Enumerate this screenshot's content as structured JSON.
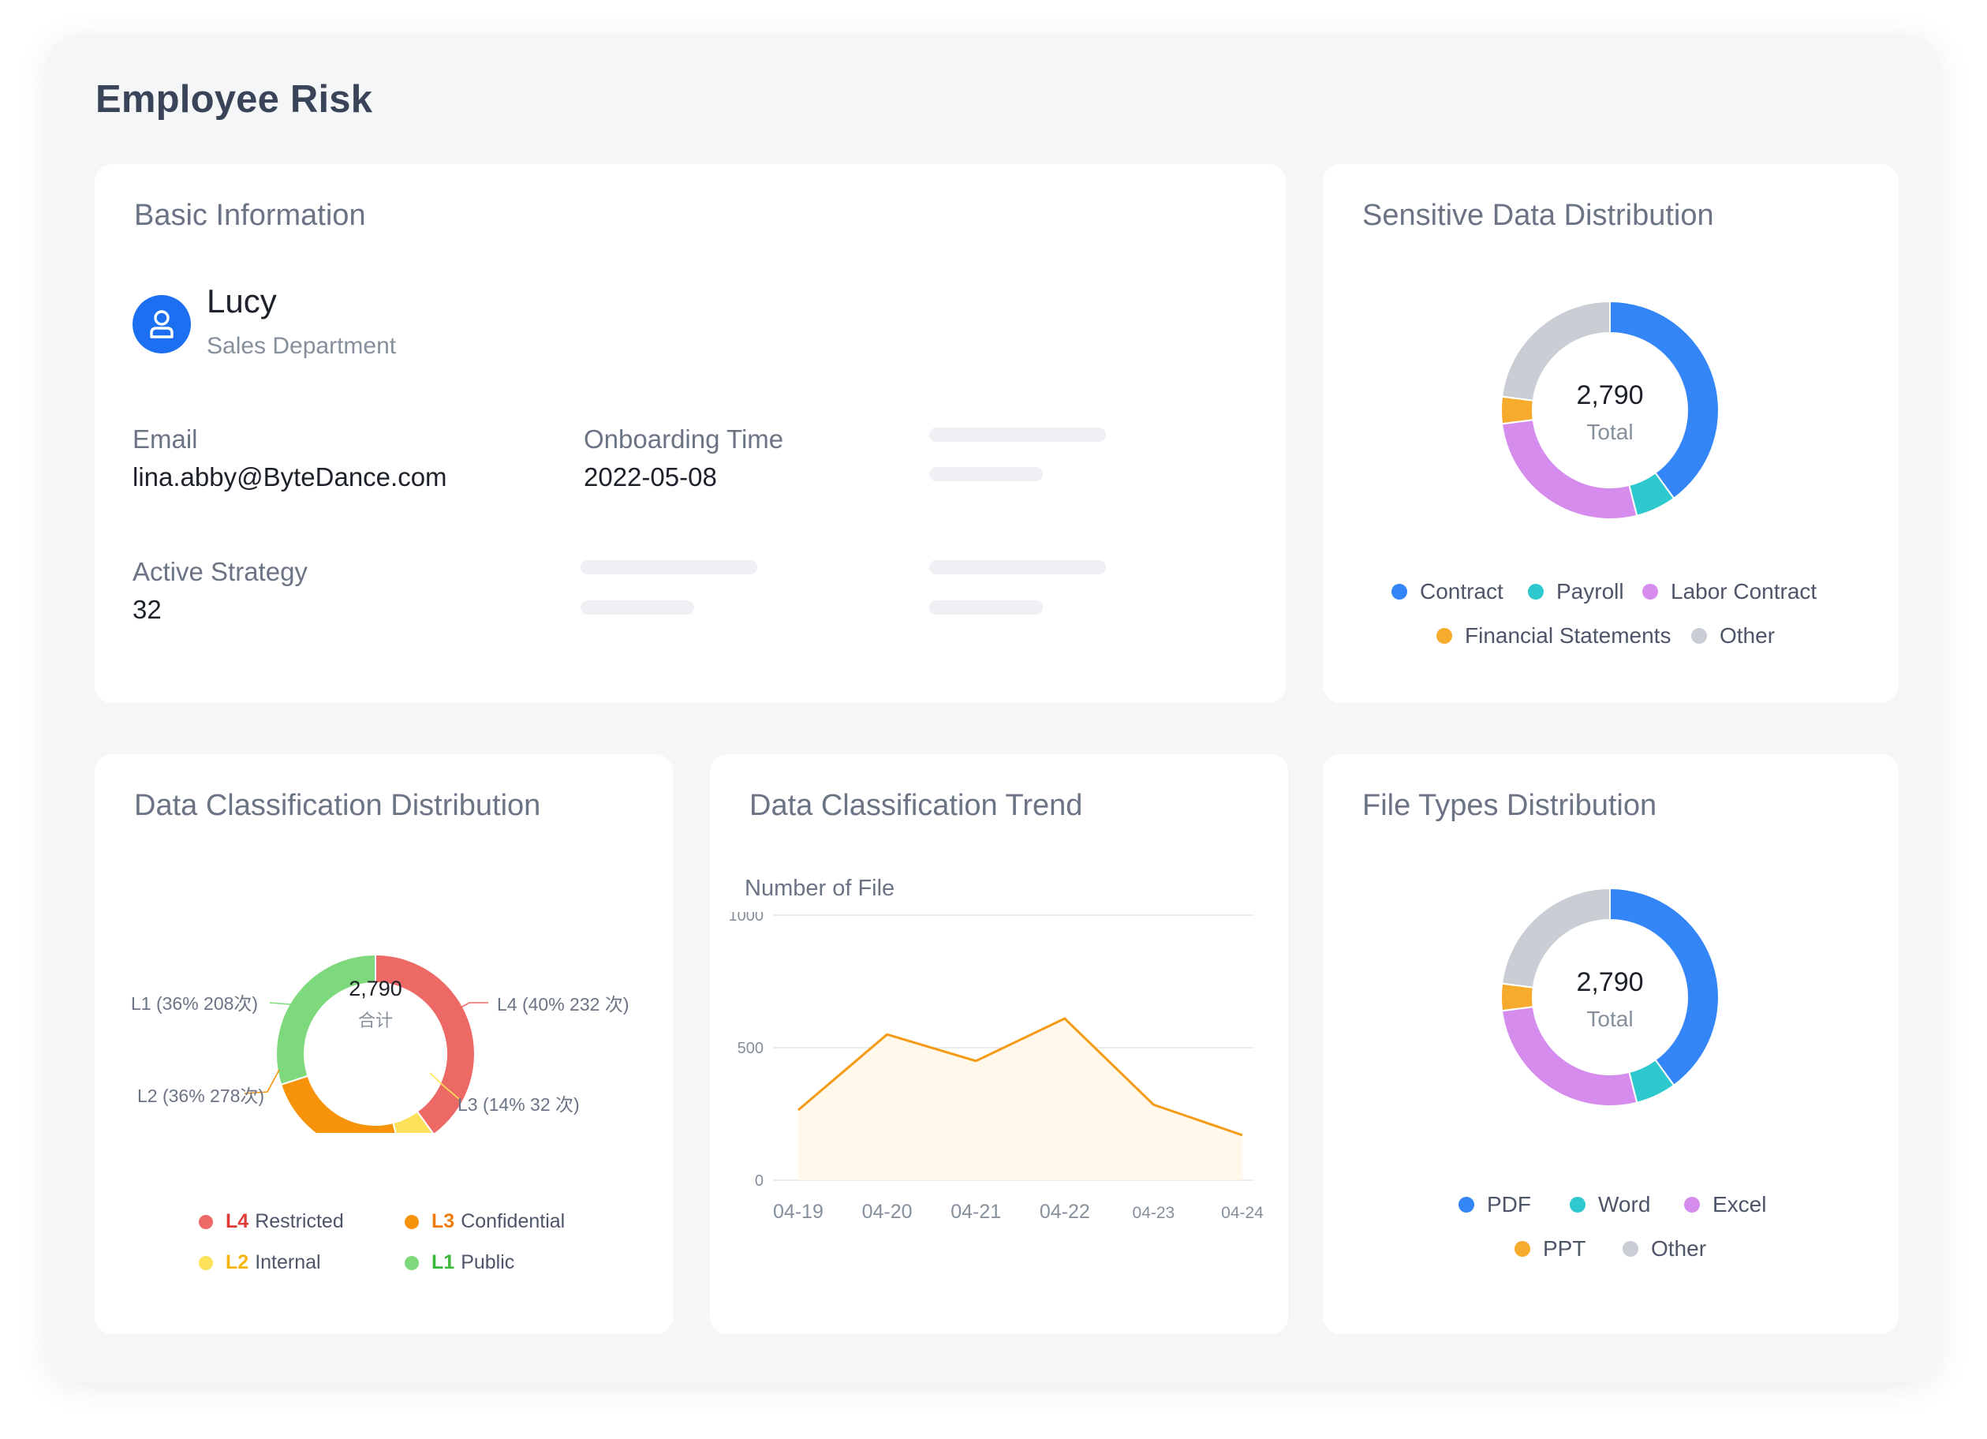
{
  "page_title": "Employee Risk",
  "basic_info": {
    "title": "Basic Information",
    "name": "Lucy",
    "department": "Sales Department",
    "email_label": "Email",
    "email_value": "lina.abby@ByteDance.com",
    "onboarding_label": "Onboarding Time",
    "onboarding_value": "2022-05-08",
    "strategy_label": "Active Strategy",
    "strategy_value": "32"
  },
  "sensitive": {
    "title": "Sensitive Data Distribution",
    "total": "2,790",
    "total_label": "Total",
    "legend": {
      "contract": "Contract",
      "payroll": "Payroll",
      "labor": "Labor Contract",
      "financial": "Financial Statements",
      "other": "Other"
    }
  },
  "classification": {
    "title": "Data Classification Distribution",
    "total": "2,790",
    "total_label": "合计",
    "labels": {
      "l4": "L4 (40% 232 次)",
      "l3": "L3 (14% 32 次)",
      "l2": "L2 (36% 278次)",
      "l1": "L1 (36% 208次)"
    },
    "legend": {
      "l4_code": "L4",
      "l4_name": "Restricted",
      "l3_code": "L3",
      "l3_name": "Confidential",
      "l2_code": "L2",
      "l2_name": "Internal",
      "l1_code": "L1",
      "l1_name": "Public"
    }
  },
  "trend": {
    "title": "Data Classification Trend",
    "ylabel": "Number of File"
  },
  "filetypes": {
    "title": "File Types Distribution",
    "total": "2,790",
    "total_label": "Total",
    "legend": {
      "pdf": "PDF",
      "word": "Word",
      "excel": "Excel",
      "ppt": "PPT",
      "other": "Other"
    }
  },
  "colors": {
    "blue": "#3485f7",
    "cyan": "#2ec9cf",
    "purple": "#d58cec",
    "orange": "#f7ab2d",
    "gray": "#c9cdd4",
    "red": "#ec6965",
    "amber": "#f7930a",
    "yellow": "#fbe25a",
    "green": "#7ed97c",
    "line": "#f59a12"
  },
  "chart_data": [
    {
      "type": "pie",
      "name": "sensitive",
      "categories": [
        "Contract",
        "Payroll",
        "Labor Contract",
        "Financial Statements",
        "Other"
      ],
      "values": [
        40,
        6,
        27,
        4,
        23
      ]
    },
    {
      "type": "pie",
      "name": "classification",
      "categories": [
        "L4",
        "L3",
        "L2",
        "L1"
      ],
      "values": [
        40,
        6,
        24,
        30
      ]
    },
    {
      "type": "area",
      "name": "trend",
      "categories": [
        "04-19",
        "04-20",
        "04-21",
        "04-22",
        "04-23",
        "04-24"
      ],
      "values": [
        265,
        550,
        450,
        610,
        285,
        170
      ],
      "x_ticks": [
        "04-19",
        "04-20",
        "04-21",
        "04-22",
        "04-23",
        "04-24"
      ],
      "y_ticks": [
        "1000",
        "500",
        "0"
      ],
      "ylim": [
        0,
        1000
      ],
      "ylabel": "Number of File",
      "grid": true
    },
    {
      "type": "pie",
      "name": "filetypes",
      "categories": [
        "PDF",
        "Word",
        "Excel",
        "PPT",
        "Other"
      ],
      "values": [
        40,
        6,
        27,
        4,
        23
      ]
    }
  ]
}
